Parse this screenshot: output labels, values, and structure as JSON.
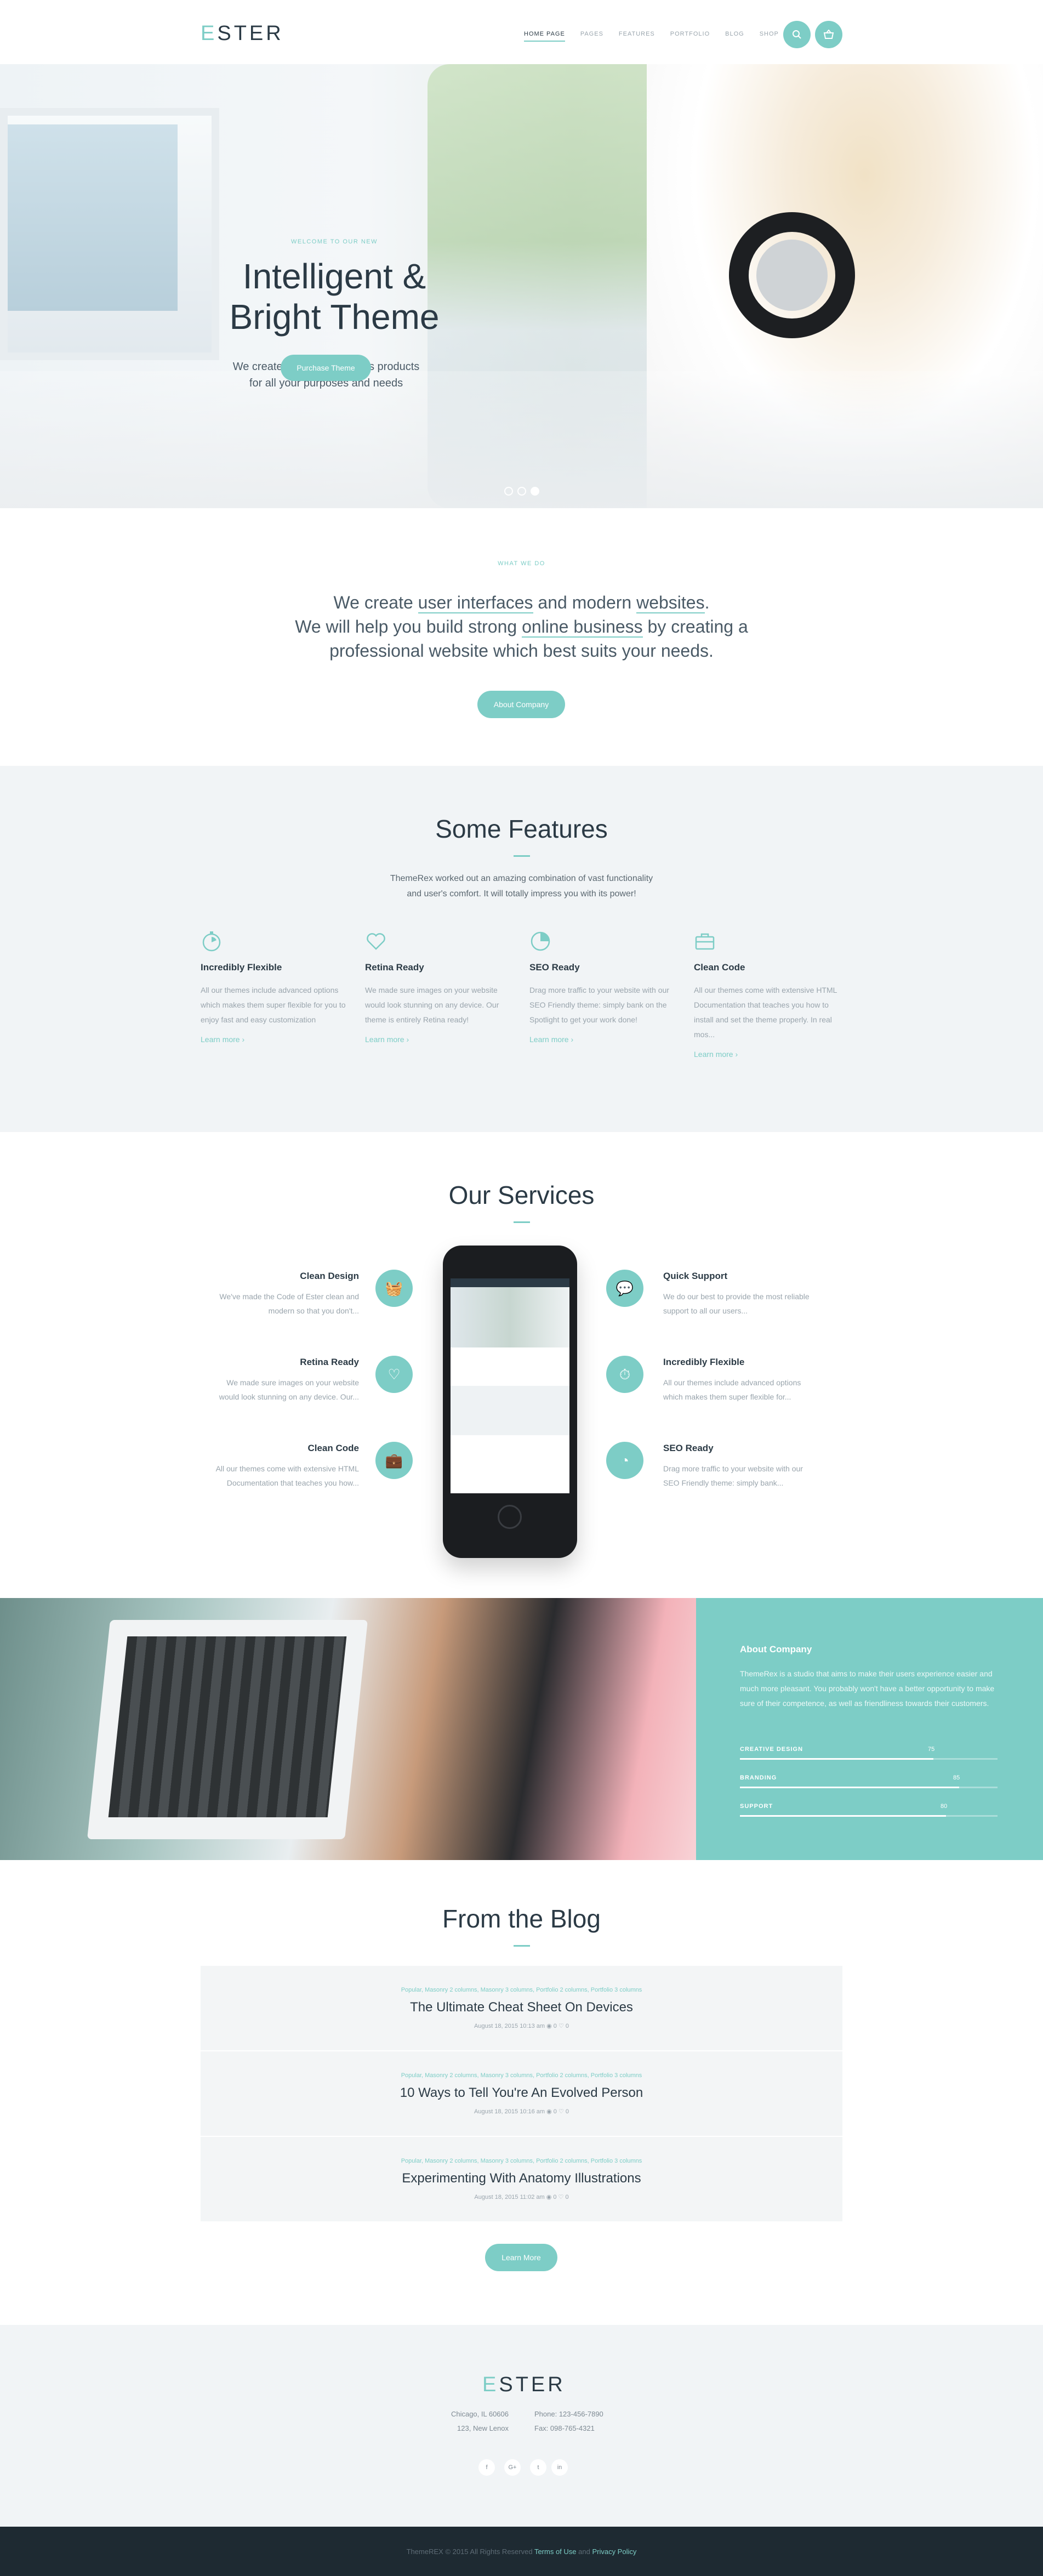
{
  "header": {
    "logo_e": "E",
    "logo_rest": "STER",
    "nav": [
      "HOME PAGE",
      "PAGES",
      "FEATURES",
      "PORTFOLIO",
      "BLOG",
      "SHOP"
    ],
    "search_icon": "search-icon",
    "cart_icon": "basket-icon"
  },
  "hero": {
    "kicker": "WELCOME TO OUR NEW",
    "title_line1": "Intelligent &",
    "title_line2": "Bright Theme",
    "sub_line1": "We create quality WordPress products",
    "sub_line2": "for all your purposes and needs",
    "button": "Purchase Theme",
    "slides": 3,
    "active_slide": 3
  },
  "whatwe": {
    "kicker": "WHAT WE DO",
    "l1_a": "We create ",
    "l1_u1": "user interfaces",
    "l1_b": " and modern ",
    "l1_u2": "websites",
    "l1_c": ".",
    "l2_a": "We will help you build strong ",
    "l2_u": "online business",
    "l2_b": " by creating a",
    "l3": "professional website which best suits your needs.",
    "button": "About Company"
  },
  "features": {
    "title": "Some Features",
    "sub_line1": "ThemeRex worked out an amazing combination of vast functionality",
    "sub_line2": "and user's comfort. It will totally impress you with its power!",
    "items": [
      {
        "icon": "timer-icon",
        "title": "Incredibly Flexible",
        "text": "All our themes include advanced options which makes them super flexible for you to enjoy fast and easy customization",
        "more": "Learn more  ›"
      },
      {
        "icon": "heart-icon",
        "title": "Retina Ready",
        "text": "We made sure images on your website would look stunning on any device. Our theme is entirely Retina ready!",
        "more": "Learn more  ›"
      },
      {
        "icon": "pie-chart-icon",
        "title": "SEO Ready",
        "text": "Drag more traffic to your website with our SEO Friendly theme: simply bank on the Spotlight to get your work done!",
        "more": "Learn more  ›"
      },
      {
        "icon": "briefcase-icon",
        "title": "Clean Code",
        "text": "All our themes come with extensive HTML Documentation that teaches you how to install and set the theme properly. In real mos...",
        "more": "Learn more  ›"
      }
    ]
  },
  "services": {
    "title": "Our Services",
    "left": [
      {
        "icon": "basket-icon",
        "title": "Clean Design",
        "text": "We've made the Code of Ester clean and modern so that you don't..."
      },
      {
        "icon": "heart-icon",
        "title": "Retina Ready",
        "text": "We made sure images on your website would look stunning on any device. Our..."
      },
      {
        "icon": "briefcase-icon",
        "title": "Clean Code",
        "text": "All our themes come with extensive HTML Documentation that teaches you how..."
      }
    ],
    "right": [
      {
        "icon": "chat-icon",
        "title": "Quick Support",
        "text": "We do our best to provide the most reliable support to all our users..."
      },
      {
        "icon": "timer-icon",
        "title": "Incredibly Flexible",
        "text": "All our themes include advanced options which makes them super flexible for..."
      },
      {
        "icon": "pie-chart-icon",
        "title": "SEO Ready",
        "text": "Drag more traffic to your website with our SEO Friendly theme: simply bank..."
      }
    ]
  },
  "about": {
    "title": "About Company",
    "text": "ThemeRex is a studio that aims to make their users experience easier and much more pleasant. You probably won't have a better opportunity to make sure of their competence, as well as friendliness towards their customers.",
    "skills": [
      {
        "label": "CREATIVE DESIGN",
        "value": 75
      },
      {
        "label": "BRANDING",
        "value": 85
      },
      {
        "label": "SUPPORT",
        "value": 80
      }
    ]
  },
  "blog": {
    "title": "From the Blog",
    "posts": [
      {
        "cats": "Popular, Masonry 2 columns, Masonry 3 columns, Portfolio 2 columns, Portfolio 3 columns",
        "title": "The Ultimate Cheat Sheet On Devices",
        "meta": "August 18, 2015 10:13 am    ◉  0    ♡  0"
      },
      {
        "cats": "Popular, Masonry 2 columns, Masonry 3 columns, Portfolio 2 columns, Portfolio 3 columns",
        "title": "10 Ways to Tell You're An Evolved Person",
        "meta": "August 18, 2015 10:16 am    ◉  0    ♡  0"
      },
      {
        "cats": "Popular, Masonry 2 columns, Masonry 3 columns, Portfolio 2 columns, Portfolio 3 columns",
        "title": "Experimenting With Anatomy Illustrations",
        "meta": "August 18, 2015 11:02 am    ◉  0    ♡  0"
      }
    ],
    "button": "Learn More"
  },
  "footer": {
    "logo_e": "E",
    "logo_rest": "STER",
    "addr1": "Chicago, IL 60606",
    "addr2": "123, New Lenox",
    "phone": "Phone: 123-456-7890",
    "fax": "Fax: 098-765-4321",
    "social": [
      "f",
      "G+",
      "t",
      "in"
    ],
    "copy_a": "ThemeREX © 2015 All Rights Reserved ",
    "terms": "Terms of Use",
    "and": " and ",
    "privacy": "Privacy Policy"
  },
  "colors": {
    "accent": "#7dcdc6",
    "dark": "#1e2a32",
    "text": "#2b3a45"
  }
}
